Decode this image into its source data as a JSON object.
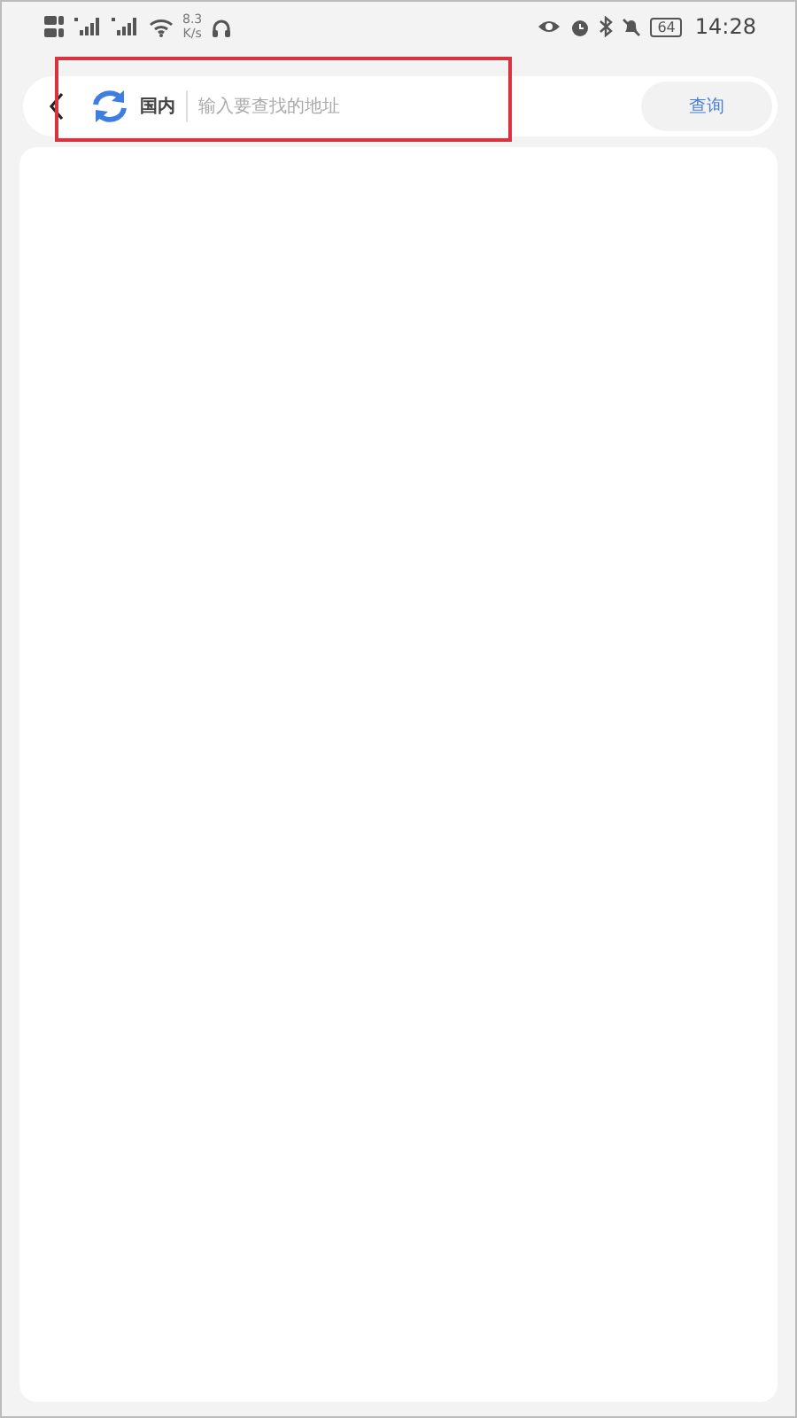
{
  "status_bar": {
    "speed": "8.3",
    "speed_unit": "K/s",
    "battery": "64",
    "time": "14:28"
  },
  "search_bar": {
    "region": "国内",
    "placeholder": "输入要查找的地址",
    "button": "查询"
  },
  "annotation": {
    "kind": "highlight"
  }
}
